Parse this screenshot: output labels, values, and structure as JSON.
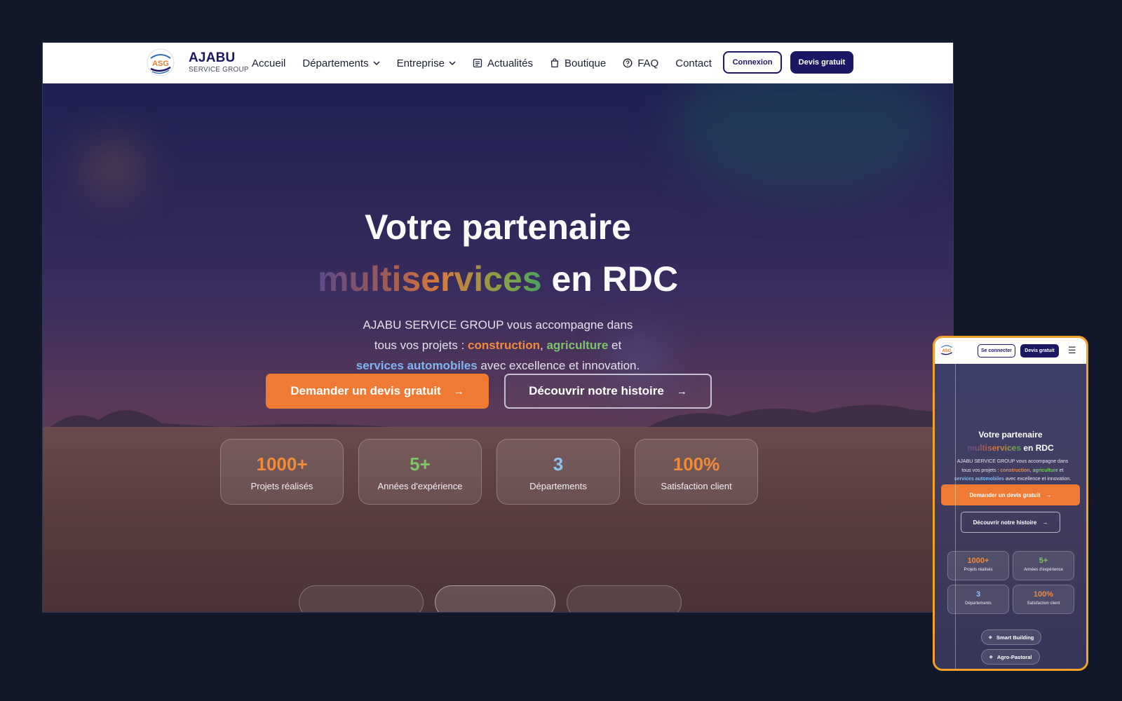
{
  "colors": {
    "page_bg": "#121827",
    "brand_navy": "#1b1763",
    "accent_orange": "#ee7a34",
    "accent_green": "#7cc56a",
    "accent_blue": "#7fb5f0",
    "mobile_frame": "#f2a12a"
  },
  "brand": {
    "logo_text": "ASG",
    "name": "AJABU",
    "tagline": "SERVICE GROUP"
  },
  "nav": {
    "items": [
      {
        "label": "Accueil",
        "icon": ""
      },
      {
        "label": "Départements",
        "icon": "chevron-down-icon"
      },
      {
        "label": "Entreprise",
        "icon": "chevron-down-icon"
      },
      {
        "label": "Actualités",
        "icon": "newspaper-icon"
      },
      {
        "label": "Boutique",
        "icon": "shopping-bag-icon"
      },
      {
        "label": "FAQ",
        "icon": "help-circle-icon"
      },
      {
        "label": "Contact",
        "icon": ""
      }
    ],
    "login_label": "Connexion",
    "quote_label": "Devis gratuit"
  },
  "hero": {
    "title_line1": "Votre partenaire",
    "title_highlight": "multiservices",
    "title_line2_rest": "en RDC",
    "subtitle_part1": "AJABU SERVICE GROUP vous accompagne dans",
    "subtitle_part2": "tous vos projets :",
    "kw_construction": "construction",
    "comma": ",",
    "kw_agriculture": "agriculture",
    "and_word": "et",
    "kw_auto": "services automobiles",
    "subtitle_end": "avec excellence et innovation.",
    "cta_primary": "Demander un devis gratuit",
    "cta_secondary": "Découvrir notre histoire"
  },
  "stats": [
    {
      "value": "1000+",
      "label": "Projets réalisés",
      "color": "#f08a3c"
    },
    {
      "value": "5+",
      "label": "Années d'expérience",
      "color": "#7cc56a"
    },
    {
      "value": "3",
      "label": "Départements",
      "color": "#8fc0f2"
    },
    {
      "value": "100%",
      "label": "Satisfaction client",
      "color": "#f08a3c"
    }
  ],
  "mobile": {
    "login_label": "Se connecter",
    "quote_label": "Devis gratuit",
    "menu_icon": "hamburger-icon",
    "title_line1": "Votre partenaire",
    "title_highlight": "multiservices",
    "title_line2_rest": "en RDC",
    "subtitle_part1": "AJABU SERVICE GROUP vous accompagne dans",
    "subtitle_part2": "tous vos projets :",
    "kw_construction": "construction",
    "kw_agriculture": "agriculture",
    "and_word": "et",
    "kw_auto": "services automobiles",
    "subtitle_end": "avec excellence et innovation.",
    "cta_primary": "Demander un devis gratuit",
    "cta_secondary": "Découvrir notre histoire",
    "pills": [
      "Smart Building",
      "Agro-Pastoral"
    ]
  }
}
